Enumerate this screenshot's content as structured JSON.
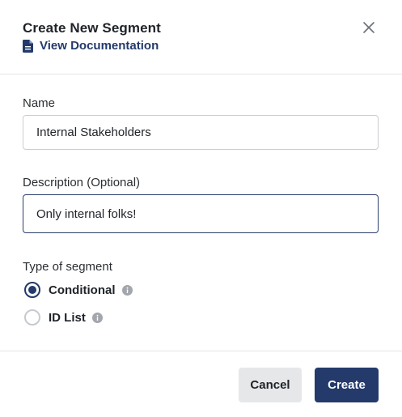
{
  "dialog": {
    "title": "Create New Segment",
    "doc_link": "View Documentation",
    "close_icon": "close-icon",
    "doc_icon": "document-icon"
  },
  "form": {
    "name_label": "Name",
    "name_value": "Internal Stakeholders",
    "description_label": "Description (Optional)",
    "description_value": "Only internal folks!",
    "type_label": "Type of segment",
    "options": [
      {
        "label": "Conditional",
        "selected": true,
        "icon": "info-icon"
      },
      {
        "label": "ID List",
        "selected": false,
        "icon": "info-icon"
      }
    ]
  },
  "footer": {
    "cancel_label": "Cancel",
    "create_label": "Create"
  },
  "colors": {
    "accent": "#233a6b",
    "cancel_bg": "#e6e7e9",
    "border": "#c9cdd2"
  }
}
